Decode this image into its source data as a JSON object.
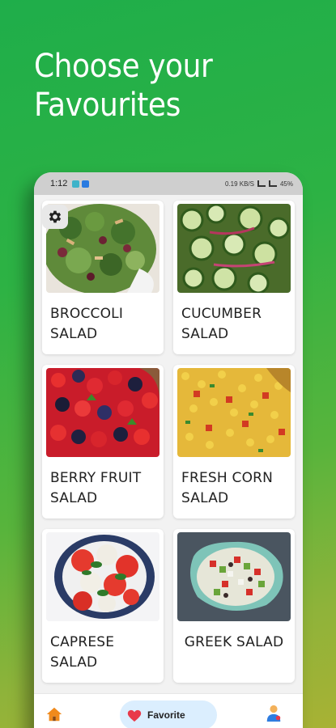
{
  "headline": {
    "line1": "Choose your",
    "line2": "Favourites"
  },
  "status_bar": {
    "time": "1:12",
    "right_text": "0.19 KB/S",
    "battery": "45%"
  },
  "salads": [
    {
      "name": "BROCCOLI SALAD",
      "line1": "BROCCOLI",
      "line2": "SALAD",
      "image_icon": "broccoli-salad-photo"
    },
    {
      "name": "CUCUMBER SALAD",
      "line1": "CUCUMBER",
      "line2": "SALAD",
      "image_icon": "cucumber-salad-photo"
    },
    {
      "name": "BERRY FRUIT SALAD",
      "line1": "BERRY FRUIT",
      "line2": "SALAD",
      "image_icon": "berry-salad-photo"
    },
    {
      "name": "FRESH CORN SALAD",
      "line1": "FRESH CORN",
      "line2": "SALAD",
      "image_icon": "corn-salad-photo"
    },
    {
      "name": "CAPRESE SALAD",
      "line1": "CAPRESE",
      "line2": "SALAD",
      "image_icon": "caprese-salad-photo"
    },
    {
      "name": "GREEK SALAD",
      "line1": "GREEK SALAD",
      "line2": "",
      "image_icon": "greek-salad-photo"
    }
  ],
  "bottom_nav": {
    "home_icon": "home-icon",
    "favorite_label": "Favorite",
    "favorite_icon": "heart-icon",
    "profile_icon": "profile-icon"
  },
  "colors": {
    "background_start": "#1fae4a",
    "background_end": "#a8b234",
    "nav_active_pill": "#dbeefe",
    "heart": "#e8394a",
    "home": "#f08a1c"
  }
}
